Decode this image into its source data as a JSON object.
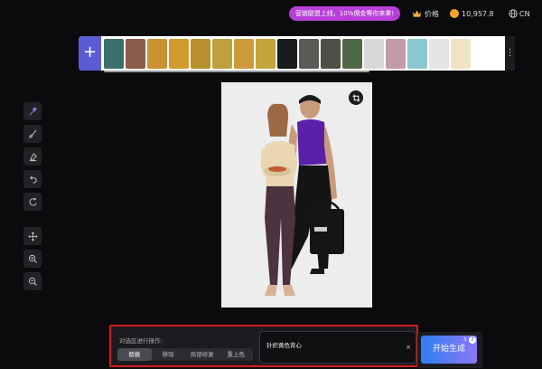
{
  "topbar": {
    "promo_text": "营销联盟上线，10%佣金等你来拿!",
    "price_label": "价格",
    "coin_balance": "10,957.8",
    "language": "CN"
  },
  "colors": {
    "promo_bg": "#b83fd8",
    "accent": "#5b5bd6",
    "selection_border": "#d51c1c",
    "generate_gradient_start": "#2f7ff2",
    "generate_gradient_end": "#8a78f5",
    "coin": "#f2a629"
  },
  "strip": {
    "add_icon": "plus-icon",
    "more_icon": "more-vertical-icon",
    "thumbnails": [
      {
        "name": "woman-portrait-thumb",
        "color": "#3b6f6a"
      },
      {
        "name": "woman-standing-thumb",
        "color": "#8a5d4c"
      },
      {
        "name": "wheat-field-thumb-1",
        "color": "#c99332"
      },
      {
        "name": "wheat-field-thumb-2",
        "color": "#d19a2a"
      },
      {
        "name": "wheat-field-thumb-3",
        "color": "#b8902d"
      },
      {
        "name": "wheat-field-thumb-4",
        "color": "#bea13e"
      },
      {
        "name": "wheat-field-thumb-5",
        "color": "#cc9a3a"
      },
      {
        "name": "wheat-field-thumb-6",
        "color": "#c4a43c"
      },
      {
        "name": "calligraphy-thumb",
        "color": "#1b1b1b"
      },
      {
        "name": "clothing-thumb-1",
        "color": "#5a5a56"
      },
      {
        "name": "clothing-thumb-2",
        "color": "#4e4f47"
      },
      {
        "name": "clothing-thumb-3",
        "color": "#4f6948"
      },
      {
        "name": "clothing-thumb-4",
        "color": "#d8d8d8"
      },
      {
        "name": "clothing-thumb-5",
        "color": "#c29ba8"
      },
      {
        "name": "bowl-thumb-1",
        "color": "#8cc7d1"
      },
      {
        "name": "bowl-thumb-2",
        "color": "#e4e4e4"
      },
      {
        "name": "bowl-thumb-3",
        "color": "#f0e2c4"
      }
    ]
  },
  "tools": {
    "group1": [
      "magic-select-icon",
      "brush-icon",
      "eraser-icon",
      "undo-icon",
      "redo-icon"
    ],
    "group2": [
      "move-icon",
      "zoom-in-icon",
      "zoom-out-icon"
    ]
  },
  "canvas": {
    "crop_icon": "crop-icon"
  },
  "bottom_panel": {
    "op_label": "对选区进行操作:",
    "tabs": [
      "替换",
      "移除",
      "局部修复",
      "重上色"
    ],
    "active_tab": "替换",
    "prompt_value": "针织黄色背心",
    "clear_icon": "×"
  },
  "generate": {
    "label": "开始生成",
    "count": "3",
    "help_icon": "?"
  }
}
